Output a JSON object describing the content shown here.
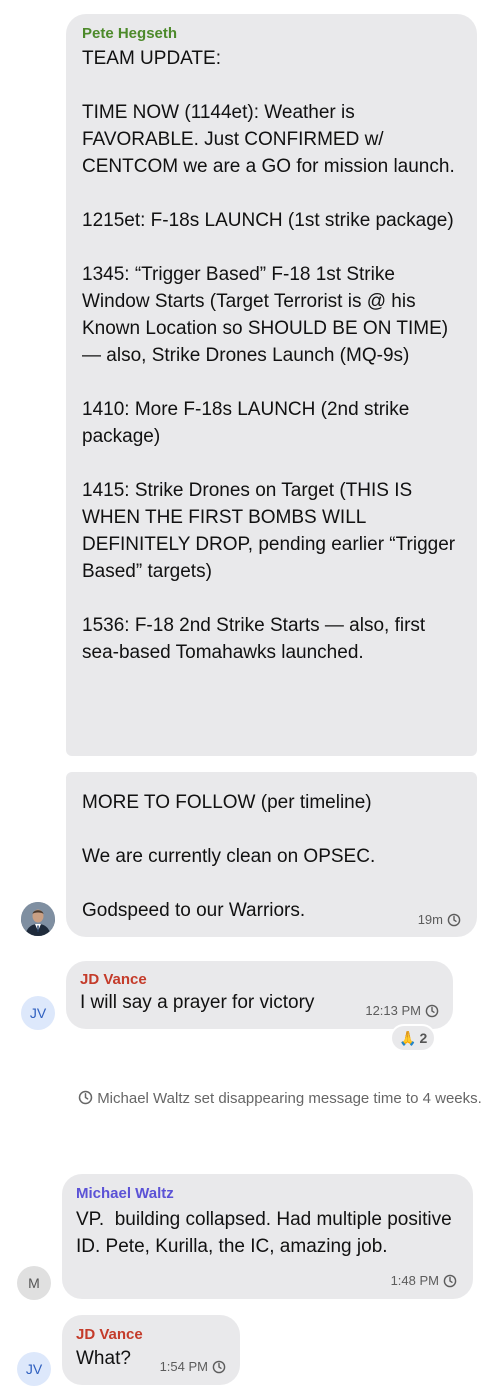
{
  "messages": {
    "pete": {
      "sender": "Pete Hegseth",
      "sender_color": "#4d8a2b",
      "part1": "TEAM UPDATE:\n\nTIME NOW (1144et): Weather is FAVORABLE. Just CONFIRMED w/ CENTCOM we are a GO for mission launch.\n\n1215et: F-18s LAUNCH (1st strike package)\n\n1345: “Trigger Based” F-18 1st Strike Window Starts (Target Terrorist is @ his Known Location so SHOULD BE ON TIME) — also, Strike Drones Launch (MQ-9s)\n\n1410: More F-18s LAUNCH (2nd strike package)\n\n1415: Strike Drones on Target (THIS IS WHEN THE FIRST BOMBS WILL DEFINITELY DROP, pending earlier “Trigger Based” targets)\n\n1536: F-18 2nd Strike Starts — also, first sea-based Tomahawks launched.",
      "part2": "MORE TO FOLLOW (per timeline)\n\nWe are currently clean on OPSEC.\n\nGodspeed to our Warriors.",
      "time": "19m",
      "avatar_icon": "person-photo-icon"
    },
    "jd1": {
      "sender": "JD Vance",
      "sender_color": "#c43b2a",
      "text": "I will say a prayer for victory",
      "time": "12:13 PM",
      "avatar": "JV",
      "reaction_emoji": "🙏",
      "reaction_count": "2"
    },
    "system": {
      "text": "Michael Waltz set disappearing message time to 4 weeks."
    },
    "waltz": {
      "sender": "Michael Waltz",
      "sender_color": "#5b52d6",
      "text": "VP.  building collapsed. Had multiple positive ID. Pete, Kurilla, the IC, amazing job.",
      "time": "1:48 PM",
      "avatar": "M"
    },
    "jd2": {
      "sender": "JD Vance",
      "sender_color": "#c43b2a",
      "text": "What?",
      "time": "1:54 PM",
      "avatar": "JV"
    }
  }
}
